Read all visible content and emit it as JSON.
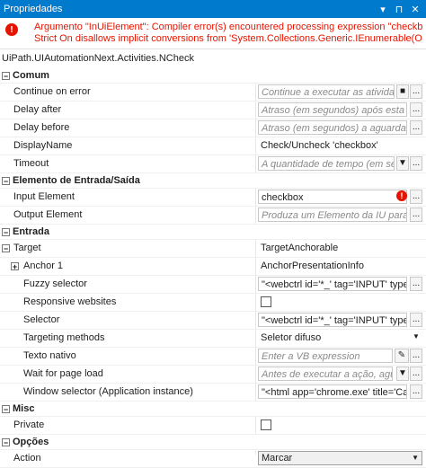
{
  "window": {
    "title": "Propriedades",
    "controls": [
      "▾",
      "⊓",
      "✕"
    ]
  },
  "error": {
    "message_line1": "Argumento \"InUiElement\": Compiler error(s) encountered processing expression \"checkbox\". Option",
    "message_line2": "Strict On disallows implicit conversions from 'System.Collections.Generic.IEnumerable(Of UiPath.C...",
    "color": "#e51400"
  },
  "type_name": "UiPath.UIAutomationNext.Activities.NCheck",
  "categories": {
    "comum": "Comum",
    "elemento": "Elemento de Entrada/Saída",
    "entrada": "Entrada",
    "misc": "Misc",
    "opcoes": "Opções"
  },
  "props": {
    "continue_on_error": {
      "name": "Continue on error",
      "placeholder": "Continue a executar as atividades"
    },
    "delay_after": {
      "name": "Delay after",
      "placeholder": "Atraso (em segundos) após esta atividade"
    },
    "delay_before": {
      "name": "Delay before",
      "placeholder": "Atraso (em segundos) a aguardar antes"
    },
    "display_name": {
      "name": "DisplayName",
      "value": "Check/Uncheck 'checkbox'"
    },
    "timeout": {
      "name": "Timeout",
      "placeholder": "A quantidade de tempo (em segundos)"
    },
    "input_element": {
      "name": "Input Element",
      "value": "checkbox"
    },
    "output_element": {
      "name": "Output Element",
      "placeholder": "Produza um Elemento da IU para utilizar"
    },
    "target": {
      "name": "Target",
      "value": "TargetAnchorable"
    },
    "anchor1": {
      "name": "Anchor 1",
      "value": "AnchorPresentationInfo"
    },
    "fuzzy_selector": {
      "name": "Fuzzy selector",
      "value": "\"<webctrl id='*_' tag='INPUT' type='c"
    },
    "responsive_websites": {
      "name": "Responsive websites"
    },
    "selector": {
      "name": "Selector",
      "value": "\"<webctrl id='*_' tag='INPUT' type='c"
    },
    "targeting_methods": {
      "name": "Targeting methods",
      "value": "Seletor difuso"
    },
    "texto_nativo": {
      "name": "Texto nativo",
      "placeholder": "Enter a VB expression"
    },
    "wait_for_page_load": {
      "name": "Wait for page load",
      "placeholder": "Antes de executar a ação, aguarde"
    },
    "window_selector": {
      "name": "Window selector (Application instance)",
      "value": "\"<html app='chrome.exe' title='Candi"
    },
    "private": {
      "name": "Private"
    },
    "action": {
      "name": "Action",
      "value": "Marcar"
    }
  },
  "icons": {
    "ellipsis": "...",
    "expand": "+",
    "collapse": "−",
    "warning": "!",
    "dropdown": "▼"
  }
}
